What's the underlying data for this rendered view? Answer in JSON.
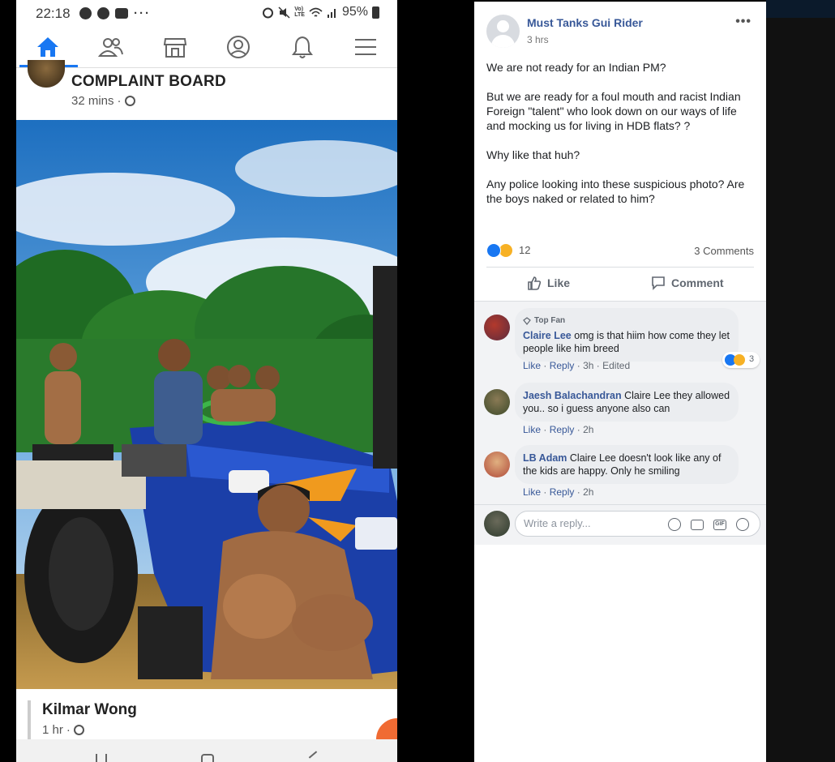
{
  "phone": {
    "status": {
      "time": "22:18",
      "battery": "95%",
      "network": "LTE"
    },
    "page_post": {
      "name": "COMPLAINT BOARD",
      "time": "32 mins",
      "separator": "·"
    },
    "next_post": {
      "name": "Kilmar Wong",
      "time": "1 hr",
      "separator": "·"
    }
  },
  "fb_post": {
    "author": "Must Tanks Gui Rider",
    "time": "3 hrs",
    "paragraphs": [
      "We are not ready for an Indian PM?",
      "But we are ready for a foul mouth and racist Indian Foreign \"talent\" who look down on our ways of life and mocking us for living in HDB flats? ?",
      "Why like that huh?",
      "Any police looking into these suspicious photo? Are the boys naked or related to him?"
    ],
    "reactions_count": "12",
    "comments_count": "3 Comments",
    "actions": {
      "like": "Like",
      "comment": "Comment"
    },
    "comments": [
      {
        "badge": "Top Fan",
        "name": "Claire Lee",
        "text": "omg is that hiim how come they let people like him breed",
        "like": "Like",
        "reply": "Reply",
        "time": "3h",
        "edited": "Edited",
        "reaction_count": "3"
      },
      {
        "name": "Jaesh Balachandran",
        "text": "Claire Lee they allowed you.. so i guess anyone also can",
        "like": "Like",
        "reply": "Reply",
        "time": "2h"
      },
      {
        "name": "LB Adam",
        "text": "Claire Lee doesn't look like any of the kids are happy. Only he smiling",
        "like": "Like",
        "reply": "Reply",
        "time": "2h"
      }
    ],
    "reply_placeholder": "Write a reply...",
    "gif_label": "GIF",
    "separator": "·"
  },
  "colors": {
    "fb_blue": "#1877f2",
    "name_blue": "#385898",
    "haha_yellow": "#f7b125",
    "background": "#000000"
  }
}
